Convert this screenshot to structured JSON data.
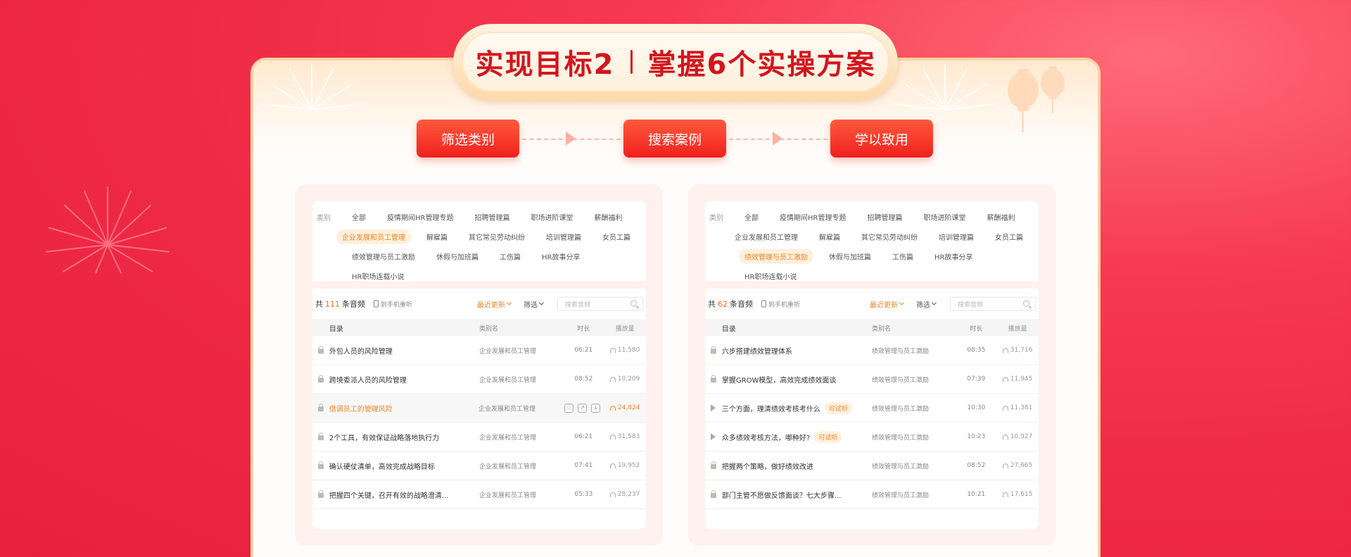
{
  "header": {
    "title_left": "实现目标2",
    "title_right": "掌握6个实操方案"
  },
  "steps": [
    {
      "label": "筛选类别"
    },
    {
      "label": "搜索案例"
    },
    {
      "label": "学以致用"
    }
  ],
  "colors": {
    "accent": "#d2161d",
    "highlight": "#e8862a",
    "button": "#f0201e"
  },
  "panels": [
    {
      "filters": {
        "label": "类别",
        "rows": [
          [
            "全部",
            "疫情期间HR管理专题",
            "招聘管理篇",
            "职场进阶课堂",
            "薪酬福利"
          ],
          [
            "企业发展和员工管理",
            "解雇篇",
            "其它常见劳动纠纷",
            "培训管理篇",
            "女员工篇"
          ],
          [
            "绩效管理与员工激励",
            "休假与加班篇",
            "工伤篇",
            "HR故事分享"
          ],
          [
            "HR职场连载小说"
          ]
        ],
        "active": "企业发展和员工管理"
      },
      "list": {
        "count_prefix": "共",
        "count": "111",
        "count_suffix": "条音频",
        "phone_label": "到手机重听",
        "sort_label": "最近更新",
        "filter_label": "筛选",
        "search_placeholder": "搜索音频",
        "columns": [
          "目录",
          "类别名",
          "时长",
          "播放量"
        ],
        "rows": [
          {
            "title": "外包人员的风险管理",
            "category": "企业发展和员工管理",
            "duration": "06:21",
            "plays": "11,580",
            "icon": "lock-icon"
          },
          {
            "title": "跨境委派人员的风险管理",
            "category": "企业发展和员工管理",
            "duration": "08:52",
            "plays": "10,209",
            "icon": "lock-icon"
          },
          {
            "title": "借调员工的管理风险",
            "category": "企业发展和员工管理",
            "duration": "",
            "plays": "24,824",
            "icon": "lock-icon",
            "highlighted": true
          },
          {
            "title": "2个工具，有效保证战略落地执行力",
            "category": "企业发展和员工管理",
            "duration": "06:21",
            "plays": "31,583",
            "icon": "lock-icon"
          },
          {
            "title": "确认硬仗清单，高效完成战略目标",
            "category": "企业发展和员工管理",
            "duration": "07:41",
            "plays": "19,952",
            "icon": "lock-icon"
          },
          {
            "title": "把握四个关键，召开有效的战略澄清...",
            "category": "企业发展和员工管理",
            "duration": "05:33",
            "plays": "28,237",
            "icon": "lock-icon"
          }
        ]
      }
    },
    {
      "filters": {
        "label": "类别",
        "rows": [
          [
            "全部",
            "疫情期间HR管理专题",
            "招聘管理篇",
            "职场进阶课堂",
            "薪酬福利"
          ],
          [
            "企业发展和员工管理",
            "解雇篇",
            "其它常见劳动纠纷",
            "培训管理篇",
            "女员工篇"
          ],
          [
            "绩效管理与员工激励",
            "休假与加班篇",
            "工伤篇",
            "HR故事分享"
          ],
          [
            "HR职场连载小说"
          ]
        ],
        "active": "绩效管理与员工激励"
      },
      "list": {
        "count_prefix": "共",
        "count": "62",
        "count_suffix": "条音频",
        "phone_label": "到手机重听",
        "sort_label": "最近更新",
        "filter_label": "筛选",
        "search_placeholder": "搜索音频",
        "columns": [
          "目录",
          "类别名",
          "时长",
          "播放量"
        ],
        "rows": [
          {
            "title": "六步搭建绩效管理体系",
            "category": "绩效管理与员工激励",
            "duration": "08:35",
            "plays": "31,716",
            "icon": "lock-icon"
          },
          {
            "title": "掌握GROW模型，高效完成绩效面谈",
            "category": "绩效管理与员工激励",
            "duration": "07:39",
            "plays": "11,945",
            "icon": "lock-icon"
          },
          {
            "title": "三个方面，理清绩效考核考什么",
            "category": "绩效管理与员工激励",
            "duration": "10:30",
            "plays": "11,381",
            "icon": "play-icon",
            "badge": "可试听"
          },
          {
            "title": "众多绩效考核方法，哪种好?",
            "category": "绩效管理与员工激励",
            "duration": "10:23",
            "plays": "10,927",
            "icon": "play-icon",
            "badge": "可试听"
          },
          {
            "title": "把握两个策略，做好绩效改进",
            "category": "绩效管理与员工激励",
            "duration": "08:52",
            "plays": "27,665",
            "icon": "lock-icon"
          },
          {
            "title": "部门主管不愿做反馈面谈？七大步骤...",
            "category": "绩效管理与员工激励",
            "duration": "10:21",
            "plays": "17,615",
            "icon": "lock-icon"
          }
        ]
      }
    }
  ]
}
